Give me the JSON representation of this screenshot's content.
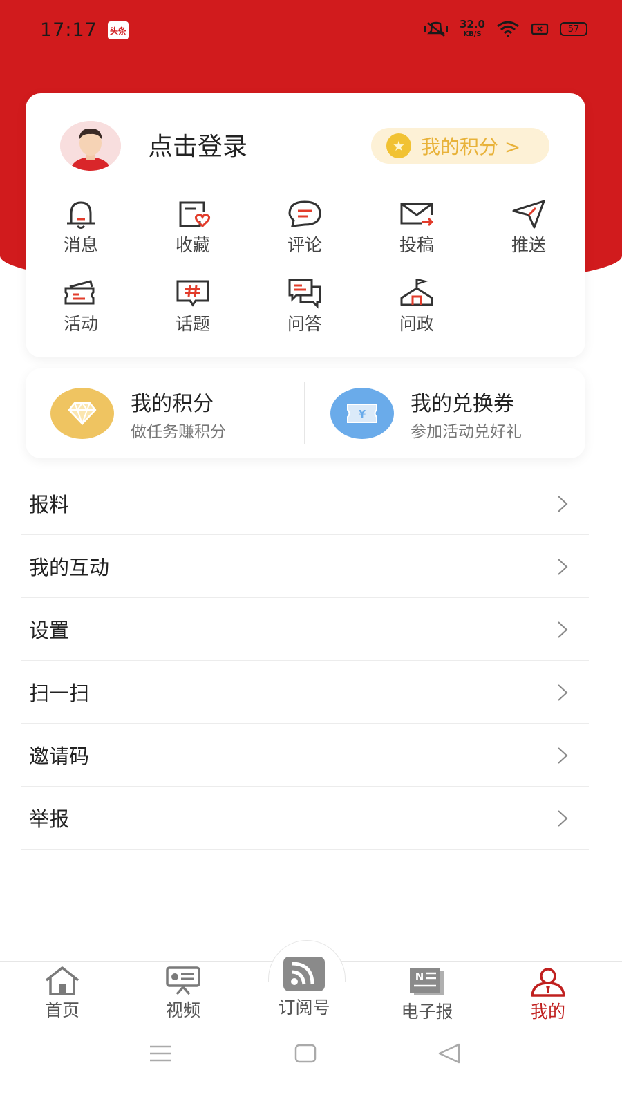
{
  "status": {
    "time": "17:17",
    "app_badge": "头条",
    "speed_value": "32.0",
    "speed_unit": "KB/S",
    "battery": "57"
  },
  "profile": {
    "login_text": "点击登录",
    "points_button": "我的积分 >"
  },
  "shortcuts": [
    {
      "label": "消息",
      "icon": "bell-icon"
    },
    {
      "label": "收藏",
      "icon": "favorite-icon"
    },
    {
      "label": "评论",
      "icon": "comment-icon"
    },
    {
      "label": "投稿",
      "icon": "mail-send-icon"
    },
    {
      "label": "推送",
      "icon": "paper-plane-icon"
    },
    {
      "label": "活动",
      "icon": "ticket-icon"
    },
    {
      "label": "话题",
      "icon": "hashtag-icon"
    },
    {
      "label": "问答",
      "icon": "qa-icon"
    },
    {
      "label": "问政",
      "icon": "government-icon"
    }
  ],
  "wallet": {
    "points_title": "我的积分",
    "points_sub": "做任务赚积分",
    "coupon_title": "我的兑换券",
    "coupon_sub": "参加活动兑好礼"
  },
  "menu": [
    {
      "label": "报料"
    },
    {
      "label": "我的互动"
    },
    {
      "label": "设置"
    },
    {
      "label": "扫一扫"
    },
    {
      "label": "邀请码"
    },
    {
      "label": "举报"
    }
  ],
  "tabs": [
    {
      "label": "首页",
      "icon": "home-icon"
    },
    {
      "label": "视频",
      "icon": "video-icon"
    },
    {
      "label": "订阅号",
      "icon": "rss-icon"
    },
    {
      "label": "电子报",
      "icon": "newspaper-icon"
    },
    {
      "label": "我的",
      "icon": "user-icon",
      "active": true
    }
  ],
  "colors": {
    "brand_red": "#d11b1d",
    "gold": "#e8b23a",
    "coupon_blue": "#6aabea"
  }
}
